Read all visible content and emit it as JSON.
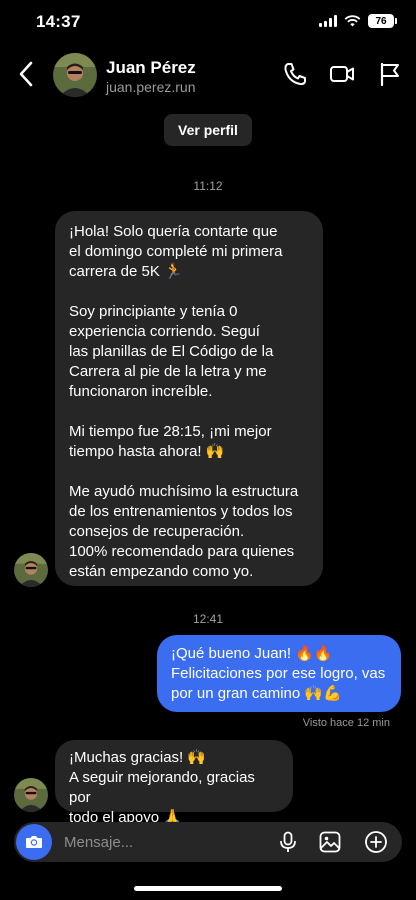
{
  "status": {
    "time": "14:37",
    "battery": "76"
  },
  "header": {
    "name": "Juan Pérez",
    "handle": "juan.perez.run"
  },
  "profile_button": "Ver perfil",
  "messages": [
    {
      "time": "11:12",
      "text": "¡Hola! Solo quería contarte que\nel domingo completé mi primera\ncarrera de 5K 🏃\n\nSoy principiante y tenía 0\nexperiencia corriendo. Seguí\nlas planillas de El Código de la\nCarrera al pie de la letra y me\nfuncionaron increíble.\n\nMi tiempo fue 28:15, ¡mi mejor\ntiempo hasta ahora! 🙌\n\nMe ayudó muchísimo la estructura\nde los entrenamientos y todos los\nconsejos de recuperación.\n100% recomendado para quienes\nestán empezando como yo."
    },
    {
      "time": "12:41",
      "text": "¡Qué bueno Juan! 🔥🔥\nFelicitaciones por ese logro, vas\npor un gran camino 🙌💪"
    },
    {
      "text": "¡Muchas gracias! 🙌\nA seguir mejorando, gracias por\ntodo el apoyo 🙏"
    }
  ],
  "seen": "Visto hace 12 min",
  "composer": {
    "placeholder": "Mensaje..."
  },
  "colors": {
    "background": "#000000",
    "incoming_bubble": "#262626",
    "outgoing_bubble": "#3a6df0"
  }
}
